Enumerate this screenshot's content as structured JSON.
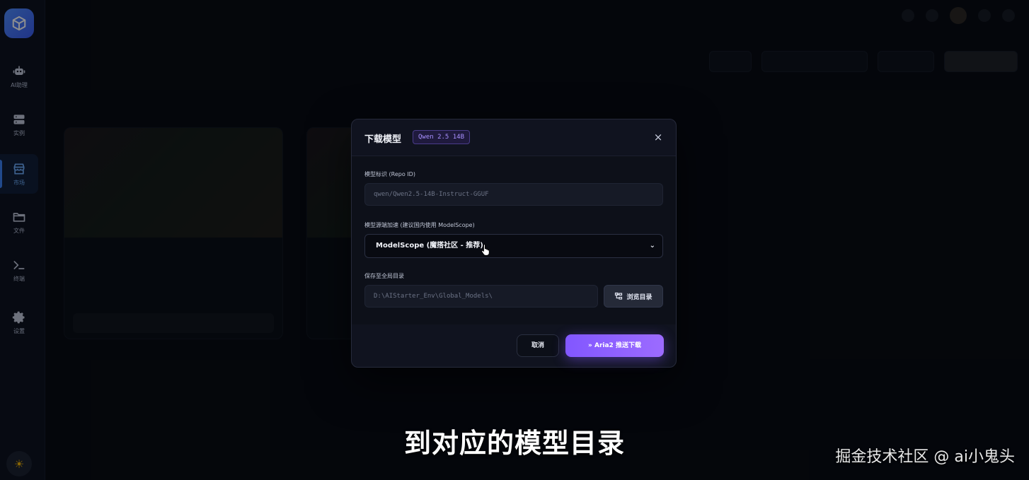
{
  "sidebar": {
    "items": [
      {
        "label": "AI助理",
        "icon": "robot-icon"
      },
      {
        "label": "实例",
        "icon": "server-icon"
      },
      {
        "label": "市场",
        "icon": "store-icon",
        "active": true
      },
      {
        "label": "文件",
        "icon": "folder-icon"
      },
      {
        "label": "终端",
        "icon": "terminal-icon"
      },
      {
        "label": "设置",
        "icon": "gear-icon"
      }
    ],
    "theme_icon": "sun-icon"
  },
  "modal": {
    "title": "下载模型",
    "model_badge": "Qwen 2.5 14B",
    "close_label": "×",
    "repo_label": "模型标识 (Repo ID)",
    "repo_value": "qwen/Qwen2.5-14B-Instruct-GGUF",
    "source_label": "模型源端加速 (建议国内使用 ModelScope)",
    "source_selected": "ModelScope (魔搭社区 - 推荐)",
    "save_label": "保存至全局目录",
    "save_path": "D:\\AIStarter_Env\\Global_Models\\",
    "browse_label": "浏览目录",
    "cancel_label": "取消",
    "download_label": "Aria2 推送下载"
  },
  "overlay_text": {
    "subtitle": "到对应的模型目录",
    "watermark": "掘金技术社区 @ ai小鬼头"
  },
  "colors": {
    "accent": "#8257ff",
    "sidebar_active": "#3b82f6",
    "theme_sun": "#f5b400"
  }
}
